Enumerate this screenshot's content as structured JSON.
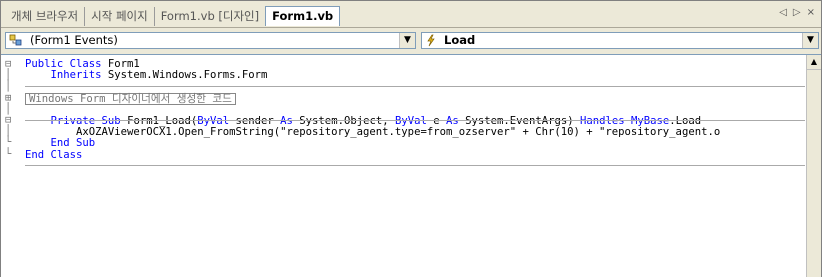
{
  "tabs": [
    {
      "label": "개체 브라우저",
      "active": false
    },
    {
      "label": "시작 페이지",
      "active": false
    },
    {
      "label": "Form1.vb [디자인]",
      "active": false
    },
    {
      "label": "Form1.vb",
      "active": true
    }
  ],
  "nav": {
    "prev": "◁",
    "next": "▷",
    "close": "×"
  },
  "combos": {
    "class": {
      "value": "(Form1 Events)",
      "icon": "class-events-icon"
    },
    "method": {
      "value": "Load",
      "icon": "lightning-event-icon"
    }
  },
  "code": {
    "line1_kw": "Public Class",
    "line1_rest": " Form1",
    "line2_kw": "Inherits",
    "line2_rest": " System.Windows.Forms.Form",
    "region": "Windows Form 디자이너에서 생성한 코드",
    "line4_kw1": "Private Sub",
    "line4_a": " Form1_Load(",
    "line4_kw2": "ByVal",
    "line4_b": " sender ",
    "line4_kw3": "As",
    "line4_c": " System.Object, ",
    "line4_kw4": "ByVal",
    "line4_d": " e ",
    "line4_kw5": "As",
    "line4_e": " System.EventArgs) ",
    "line4_kw6": "Handles",
    "line4_f": " ",
    "line4_kw7": "MyBase",
    "line4_g": ".Load",
    "line5": "AxOZAViewerOCX1.Open_FromString(\"repository_agent.type=from_ozserver\" + Chr(10) + \"repository_agent.o",
    "line6_kw": "End Sub",
    "line7_kw": "End Class"
  },
  "colors": {
    "keyword": "#0000ff",
    "background": "#ffffff",
    "chrome": "#ece9d8"
  }
}
